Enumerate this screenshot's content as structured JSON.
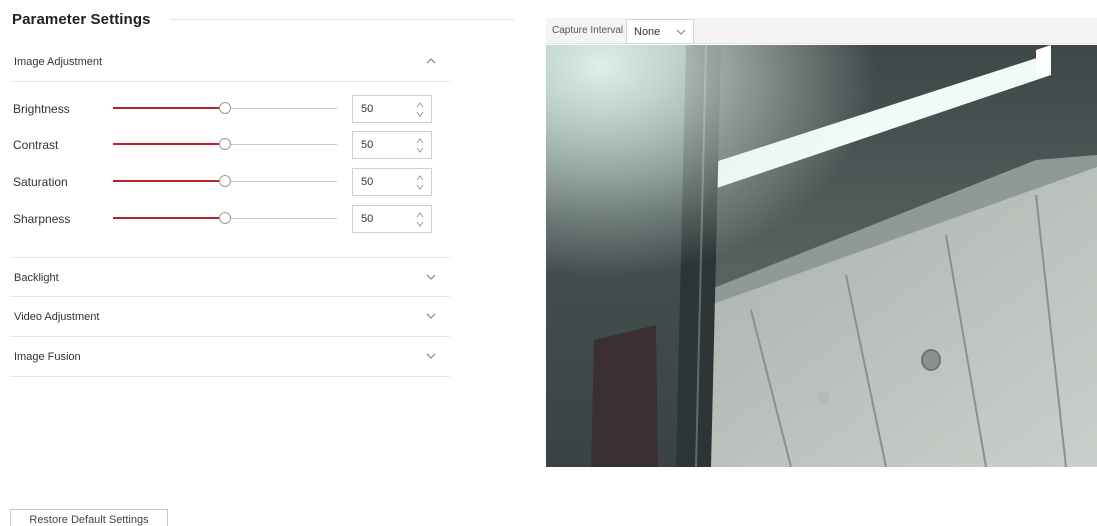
{
  "page": {
    "title": "Parameter Settings"
  },
  "sections": [
    {
      "label": "Image Adjustment",
      "expanded": true
    },
    {
      "label": "Backlight",
      "expanded": false
    },
    {
      "label": "Video Adjustment",
      "expanded": false
    },
    {
      "label": "Image Fusion",
      "expanded": false
    }
  ],
  "image_adjustment": {
    "params": [
      {
        "label": "Brightness",
        "value": "50",
        "level": 0.5
      },
      {
        "label": "Contrast",
        "value": "50",
        "level": 0.5
      },
      {
        "label": "Saturation",
        "value": "50",
        "level": 0.5
      },
      {
        "label": "Sharpness",
        "value": "50",
        "level": 0.5
      }
    ]
  },
  "preview": {
    "capture_interval_label": "Capture Interval",
    "capture_interval_value": "None"
  },
  "footer": {
    "restore_label": "Restore Default Settings"
  },
  "colors": {
    "slider_fill": "#b3242b",
    "slider_track": "#c8c8c8"
  }
}
